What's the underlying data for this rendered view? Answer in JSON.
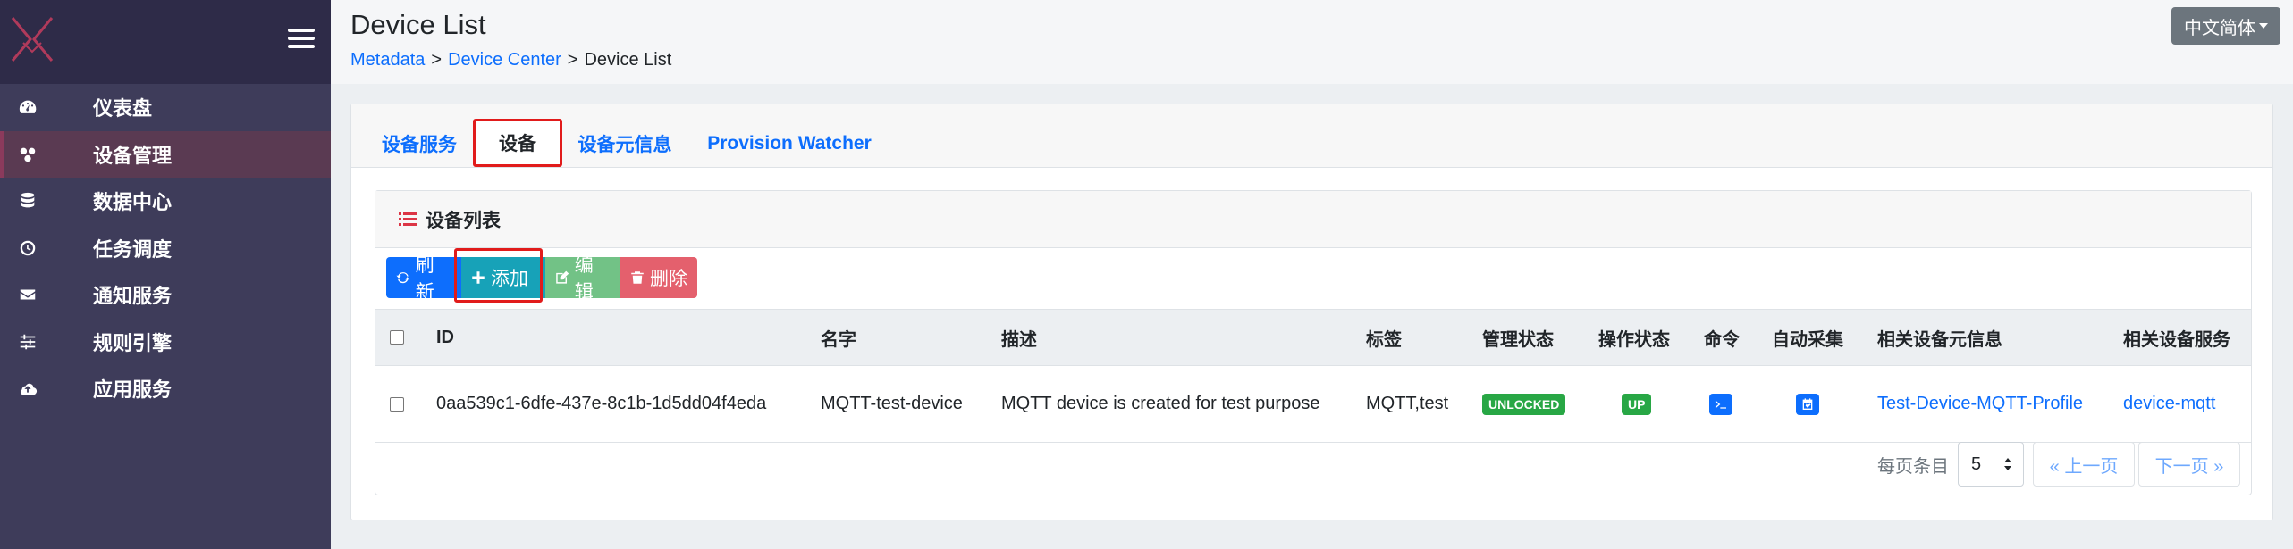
{
  "sidebar": {
    "logo": "X",
    "items": [
      {
        "icon": "dashboard-icon",
        "label": "仪表盘"
      },
      {
        "icon": "device-management-icon",
        "label": "设备管理"
      },
      {
        "icon": "database-icon",
        "label": "数据中心"
      },
      {
        "icon": "clock-icon",
        "label": "任务调度"
      },
      {
        "icon": "envelope-icon",
        "label": "通知服务"
      },
      {
        "icon": "sliders-icon",
        "label": "规则引擎"
      },
      {
        "icon": "cloud-upload-icon",
        "label": "应用服务"
      }
    ],
    "active_index": 1
  },
  "header": {
    "title": "Device List",
    "breadcrumb": [
      "Metadata",
      "Device Center",
      "Device List"
    ],
    "language": "中文简体"
  },
  "tabs": [
    "设备服务",
    "设备",
    "设备元信息",
    "Provision Watcher"
  ],
  "active_tab": 1,
  "panel": {
    "title": "设备列表",
    "buttons": {
      "refresh": "刷新",
      "add": "添加",
      "edit": "编辑",
      "delete": "删除"
    }
  },
  "table": {
    "columns": [
      "ID",
      "名字",
      "描述",
      "标签",
      "管理状态",
      "操作状态",
      "命令",
      "自动采集",
      "相关设备元信息",
      "相关设备服务"
    ],
    "rows": [
      {
        "id": "0aa539c1-6dfe-437e-8c1b-1d5dd04f4eda",
        "name": "MQTT-test-device",
        "description": "MQTT device is created for test purpose",
        "labels": "MQTT,test",
        "admin_state": "UNLOCKED",
        "operating_state": "UP",
        "profile": "Test-Device-MQTT-Profile",
        "service": "device-mqtt"
      }
    ]
  },
  "pagination": {
    "per_page_label": "每页条目",
    "per_page": "5",
    "prev": "« 上一页",
    "next": "下一页 »"
  },
  "colors": {
    "sidebar": "#3e3c5a",
    "primary": "#0d6efd",
    "info": "#17a2b8",
    "success": "#28a745",
    "danger": "#e4606d",
    "highlight": "#e11b1b"
  }
}
